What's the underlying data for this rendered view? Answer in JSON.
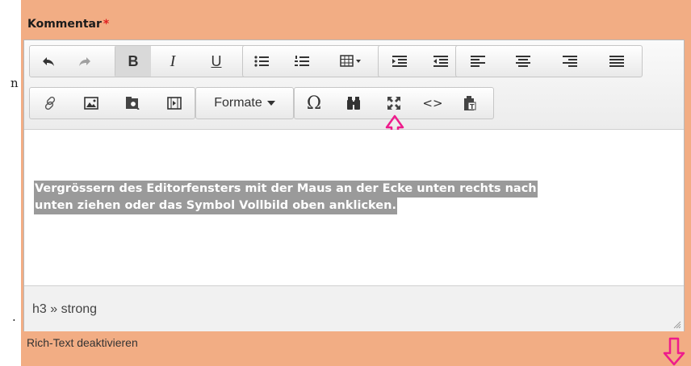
{
  "field": {
    "label": "Kommentar",
    "required_mark": "*"
  },
  "toolbar": {
    "format_combo": {
      "label": "Formate",
      "icon": "caret-down-icon"
    },
    "buttons": [
      {
        "name": "undo",
        "icon": "undo-icon"
      },
      {
        "name": "redo",
        "icon": "redo-icon"
      },
      {
        "name": "bold",
        "label": "B",
        "icon": "bold-icon"
      },
      {
        "name": "italic",
        "label": "I",
        "icon": "italic-icon"
      },
      {
        "name": "underline",
        "label": "U",
        "icon": "underline-icon"
      },
      {
        "name": "bulleted-list",
        "icon": "bulleted-list-icon"
      },
      {
        "name": "numbered-list",
        "icon": "numbered-list-icon"
      },
      {
        "name": "table",
        "icon": "table-icon"
      },
      {
        "name": "indent",
        "icon": "indent-icon"
      },
      {
        "name": "outdent",
        "icon": "outdent-icon"
      },
      {
        "name": "align-left",
        "icon": "align-left-icon"
      },
      {
        "name": "align-center",
        "icon": "align-center-icon"
      },
      {
        "name": "align-right",
        "icon": "align-right-icon"
      },
      {
        "name": "justify",
        "icon": "justify-icon"
      },
      {
        "name": "link",
        "icon": "link-icon"
      },
      {
        "name": "image",
        "icon": "image-icon"
      },
      {
        "name": "media-browser",
        "icon": "media-browser-icon"
      },
      {
        "name": "media",
        "icon": "media-icon"
      },
      {
        "name": "special-char",
        "label": "Ω",
        "icon": "omega-icon"
      },
      {
        "name": "find",
        "icon": "binoculars-icon"
      },
      {
        "name": "fullscreen",
        "icon": "fullscreen-icon"
      },
      {
        "name": "source-code",
        "label": "<>",
        "icon": "code-icon"
      },
      {
        "name": "paste-text",
        "icon": "paste-text-icon"
      }
    ]
  },
  "content": {
    "lines": [
      "Vergrössern des Editorfensters mit der Maus an der Ecke unten rechts nach",
      "unten ziehen oder das Symbol Vollbild oben anklicken."
    ]
  },
  "statusbar": {
    "path": "h3 » strong"
  },
  "footer": {
    "toggle_label": "Rich-Text deaktivieren"
  },
  "stray_glyphs": {
    "top": "n",
    "bottom": "."
  },
  "colors": {
    "panel_bg": "#f2ad84",
    "required": "#e02020",
    "annotation": "#ee1c8c",
    "selection": "#9a9a9a"
  }
}
